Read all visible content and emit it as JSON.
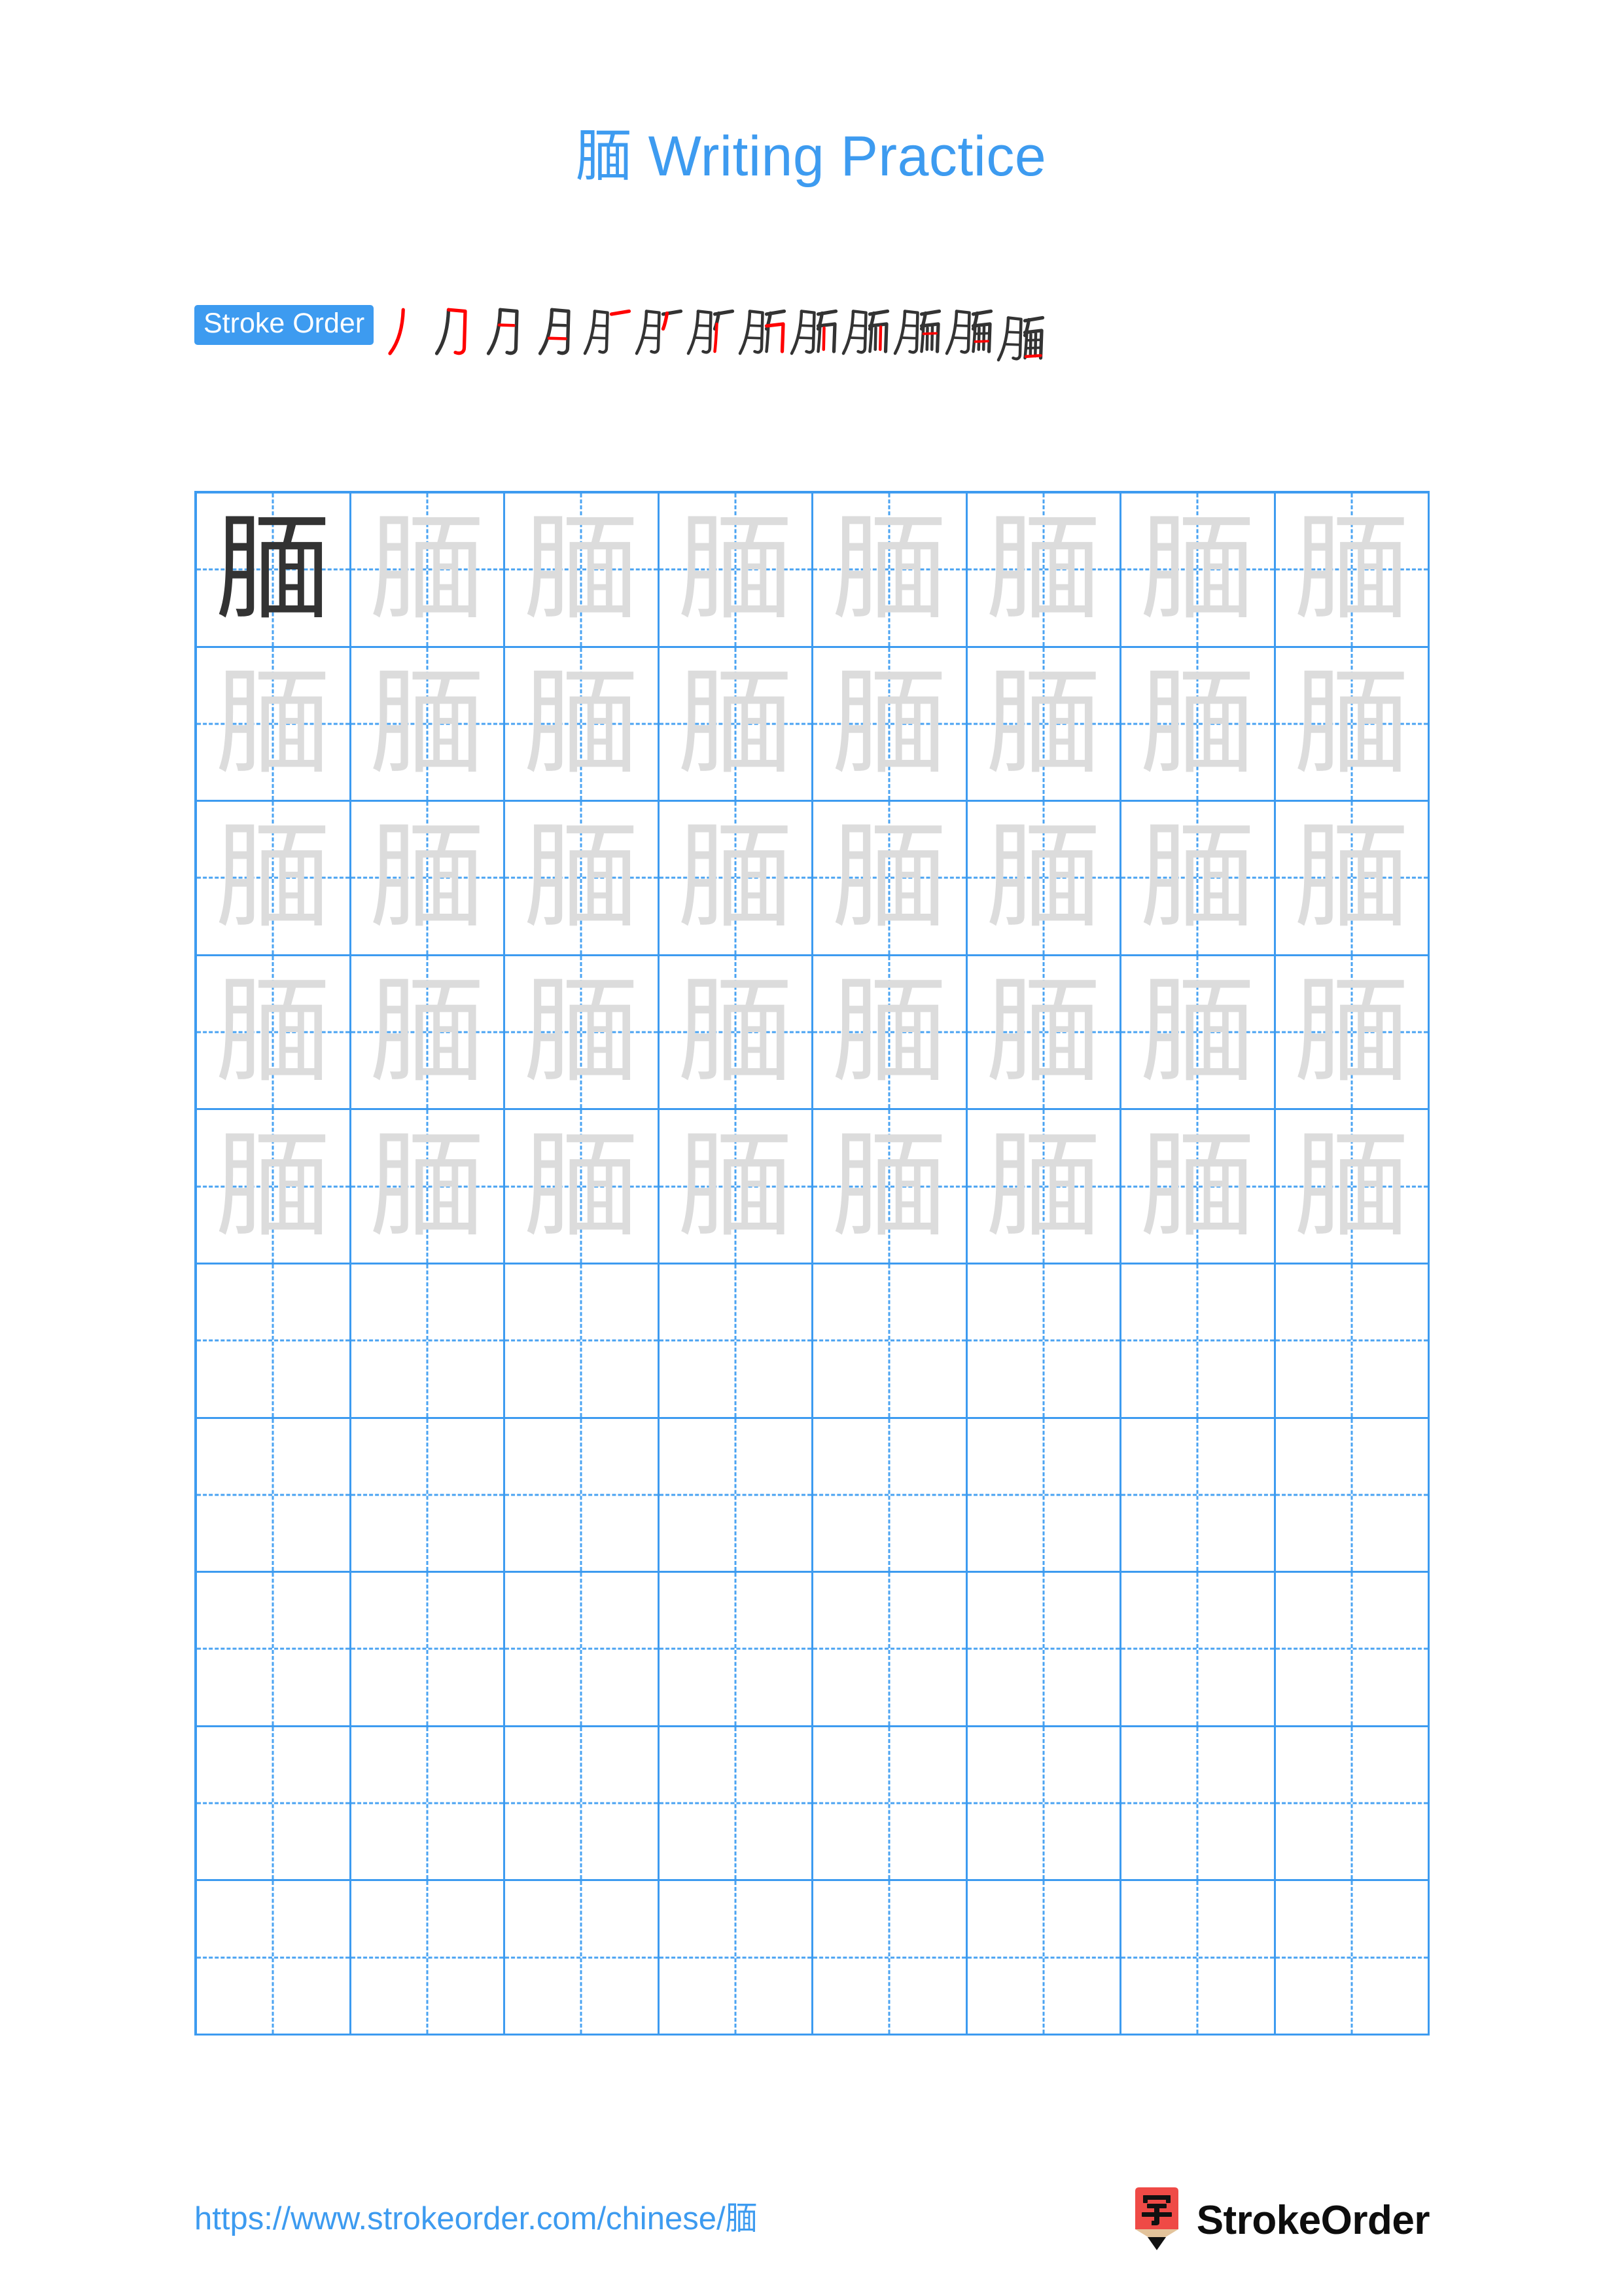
{
  "page": {
    "character": "腼",
    "title": "腼 Writing Practice",
    "background_color": "#ffffff",
    "accent_color": "#3d9bf0",
    "trace_color": "#dcdcdc",
    "model_color": "#333333",
    "highlight_stroke_color": "#ff0000"
  },
  "stroke_order": {
    "badge_label": "Stroke Order",
    "total_strokes": 13,
    "steps": [
      {
        "index": 1,
        "glyph": "丿",
        "new_stroke": "丿 left-falling"
      },
      {
        "index": 2,
        "glyph": "𠃌",
        "new_stroke": "㇆ horizontal-fold-hook"
      },
      {
        "index": 3,
        "glyph": "月",
        "new_stroke": "一 upper inner horizontal"
      },
      {
        "index": 4,
        "glyph": "月",
        "new_stroke": "一 lower inner horizontal"
      },
      {
        "index": 5,
        "glyph": "肀",
        "new_stroke": "一 top horizontal of 面"
      },
      {
        "index": 6,
        "glyph": "肀",
        "new_stroke": "丿 left-falling of 面"
      },
      {
        "index": 7,
        "glyph": "肀",
        "new_stroke": "丨 vertical of 面"
      },
      {
        "index": 8,
        "glyph": "肪",
        "new_stroke": "㇕ horizontal-fold"
      },
      {
        "index": 9,
        "glyph": "胏",
        "new_stroke": "丨 left vertical inside 面"
      },
      {
        "index": 10,
        "glyph": "腁",
        "new_stroke": "丨 right vertical inside 面"
      },
      {
        "index": 11,
        "glyph": "腼",
        "new_stroke": "一 upper inner horizontal of 面"
      },
      {
        "index": 12,
        "glyph": "腼",
        "new_stroke": "一 lower inner horizontal of 面"
      },
      {
        "index": 13,
        "glyph": "腼",
        "new_stroke": "一 bottom closing horizontal"
      }
    ]
  },
  "grid": {
    "columns": 8,
    "rows": 10,
    "guide_style": "dashed-crosshair",
    "cells": [
      [
        "腼",
        "腼",
        "腼",
        "腼",
        "腼",
        "腼",
        "腼",
        "腼"
      ],
      [
        "腼",
        "腼",
        "腼",
        "腼",
        "腼",
        "腼",
        "腼",
        "腼"
      ],
      [
        "腼",
        "腼",
        "腼",
        "腼",
        "腼",
        "腼",
        "腼",
        "腼"
      ],
      [
        "腼",
        "腼",
        "腼",
        "腼",
        "腼",
        "腼",
        "腼",
        "腼"
      ],
      [
        "腼",
        "腼",
        "腼",
        "腼",
        "腼",
        "腼",
        "腼",
        "腼"
      ],
      [
        "",
        "",
        "",
        "",
        "",
        "",
        "",
        ""
      ],
      [
        "",
        "",
        "",
        "",
        "",
        "",
        "",
        ""
      ],
      [
        "",
        "",
        "",
        "",
        "",
        "",
        "",
        ""
      ],
      [
        "",
        "",
        "",
        "",
        "",
        "",
        "",
        ""
      ],
      [
        "",
        "",
        "",
        "",
        "",
        "",
        "",
        ""
      ]
    ],
    "model_cell": {
      "row": 0,
      "col": 0
    }
  },
  "footer": {
    "url": "https://www.strokeorder.com/chinese/腼",
    "brand_name": "StrokeOrder",
    "logo_character": "字",
    "logo_body_color": "#ef4a46",
    "logo_wood_color": "#e3c39b",
    "logo_tip_color": "#111111"
  }
}
